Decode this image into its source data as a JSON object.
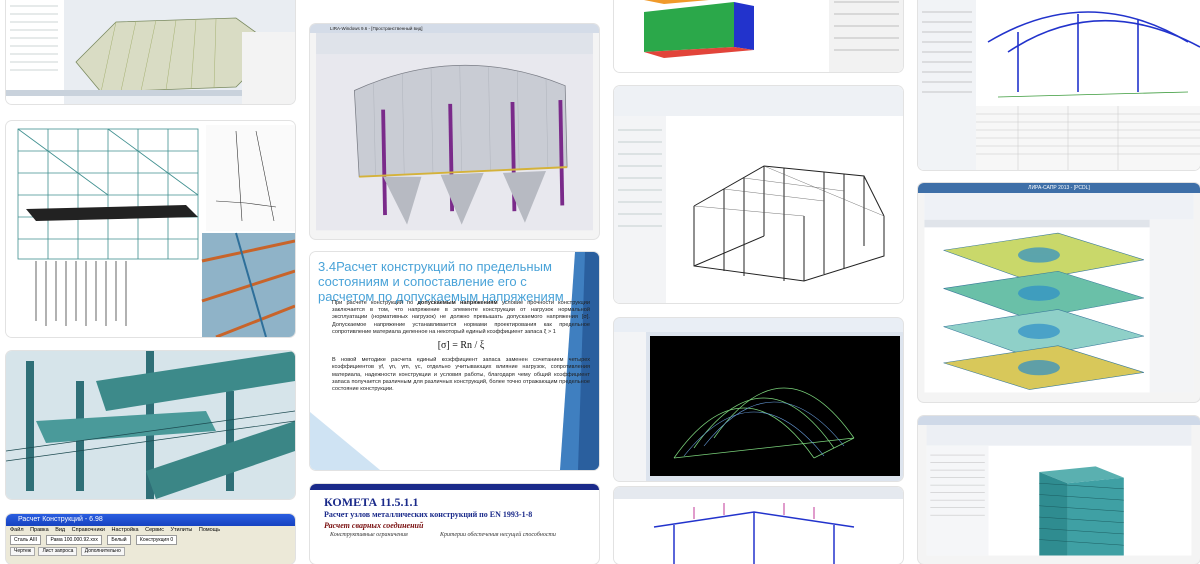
{
  "results": [
    {
      "id": "r1",
      "label": "Structural model of a long-span hall"
    },
    {
      "id": "r2",
      "label": "Multi-storey steel frame with deformation plots"
    },
    {
      "id": "r3",
      "label": "Steel pipe rack 3D render"
    },
    {
      "id": "r4",
      "label": "Расчет Конструкций"
    },
    {
      "id": "r5",
      "label": "Silo structure model"
    },
    {
      "id": "r6",
      "label": "Presentation slide 3.4"
    },
    {
      "id": "r7",
      "label": "КОМЕТА 11.5.1.1"
    },
    {
      "id": "r8",
      "label": "Building with colored walls"
    },
    {
      "id": "r9",
      "label": "Steel hangar frame"
    },
    {
      "id": "r10",
      "label": "Arched truss in CAD"
    },
    {
      "id": "r11",
      "label": "Frame with load arrows"
    },
    {
      "id": "r12",
      "label": "Arched roof frame with results table"
    },
    {
      "id": "r13",
      "label": "Multi-storey slab deformation"
    },
    {
      "id": "r14",
      "label": "High-rise analysis model"
    }
  ],
  "c4": {
    "window_title": "Расчет Конструкций - 6.98",
    "menu": [
      "Файл",
      "Правка",
      "Вид",
      "Справочники",
      "Настройка",
      "Сервис",
      "Утилиты",
      "Помощь"
    ],
    "toolbar": [
      "Сталь AIII",
      "Рама 100.000.92.xxx",
      "Белый",
      "Конструкция 0"
    ],
    "tabs": [
      "Чертеж",
      "Лист запроса",
      "Дополнительно"
    ]
  },
  "c5": {
    "window_title": "LIRA-Windows 9.6 - [Пространственный вид]"
  },
  "c6": {
    "title": "3.4Расчет конструкций по предельным состояниям и сопоставление его с расчетом по допускаемым напряжениям",
    "para1_prefix": "При расчете конструкций по ",
    "para1_bold": "допускаемым напряжениям",
    "para1_rest": " условие прочности конструкции заключается в том, что напряжение в элементе конструкции от нагрузок нормальной эксплуатации (нормативных нагрузок) не должно превышать допускаемого напряжения [σ]. Допускаемое напряжение устанавливается нормами проектирования как предельное сопротивление материала деленное на некоторый единый коэффициент запаса ξ > 1",
    "formula": "[σ] = Rn / ξ",
    "para2": "В новой методике расчета единый коэффициент запаса заменен сочетанием четырех коэффициентов γf, γn, γm, γc, отдельно учитывающих влияние нагрузок, сопротивления материала, надежности конструкции и условия работы, благодаря чему общий коэффициент запаса получается различным для различных конструкций, более точно отражающим предельное состояние конструкции."
  },
  "c7": {
    "title": "КОМЕТА 11.5.1.1",
    "subtitle": "Расчет узлов металлических конструкций по EN 1993-1-8",
    "subtitle2": "Расчет сварных соединений",
    "col1": "Конструктивные ограничения",
    "col2": "Критерии обеспечения несущей способности"
  },
  "c13": {
    "window_title": "ЛИРА-САПР 2013 - [PCDL]"
  },
  "colors": {
    "steel_teal": "#3f8f8f",
    "frame_blue": "#2233cc",
    "member_purple": "#7a2a8a",
    "cad_black": "#000000",
    "slide_accent": "#4aa3d8"
  }
}
